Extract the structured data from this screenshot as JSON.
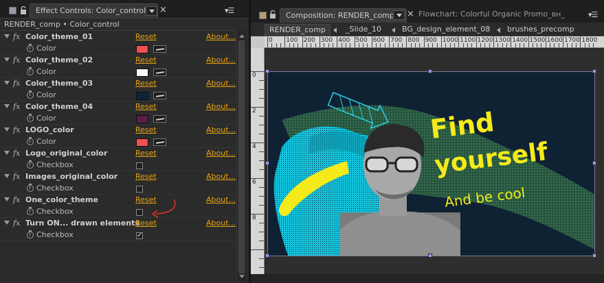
{
  "left_panel": {
    "tab_title": "Effect Controls: Color_control",
    "breadcrumb": "RENDER_comp • Color_control",
    "effects": [
      {
        "name": "Color_theme_01",
        "reset": "Reset",
        "about": "About...",
        "prop": "Color",
        "kind": "color",
        "color": "#f25050"
      },
      {
        "name": "Color_theme_02",
        "reset": "Reset",
        "about": "About...",
        "prop": "Color",
        "kind": "color",
        "color": "#f4faf2"
      },
      {
        "name": "Color_theme_03",
        "reset": "Reset",
        "about": "About...",
        "prop": "Color",
        "kind": "color",
        "color": "#0c2436"
      },
      {
        "name": "Color_theme_04",
        "reset": "Reset",
        "about": "About...",
        "prop": "Color",
        "kind": "color",
        "color": "#5a1e46"
      },
      {
        "name": "LOGO_color",
        "reset": "Reset",
        "about": "About...",
        "prop": "Color",
        "kind": "color",
        "color": "#f25050"
      },
      {
        "name": "Logo_original_color",
        "reset": "Reset",
        "about": "About...",
        "prop": "Checkbox",
        "kind": "checkbox",
        "checked": false
      },
      {
        "name": "Images_original_color",
        "reset": "Reset",
        "about": "About...",
        "prop": "Checkbox",
        "kind": "checkbox",
        "checked": false
      },
      {
        "name": "One_color_theme",
        "reset": "Reset",
        "about": "About...",
        "prop": "Checkbox",
        "kind": "checkbox",
        "checked": false
      },
      {
        "name": "Turn ON... drawn elements",
        "reset": "Reset",
        "about": "About...",
        "prop": "Checkbox",
        "kind": "checkbox",
        "checked": true
      }
    ],
    "checkmark_glyph": "✓",
    "fx_glyph": "fx"
  },
  "right_panel": {
    "tab_title": "Composition: RENDER_comp",
    "second_tab_title": "Flowchart: Colorful Organic Promo_вн_",
    "layer_tabs": [
      "RENDER_comp",
      "_Slide_10",
      "BG_design_element_08",
      "brushes_precomp"
    ],
    "ruler_labels": [
      "0",
      "100",
      "200",
      "300",
      "400",
      "500",
      "600",
      "700",
      "800",
      "900",
      "1000",
      "1100",
      "1200",
      "1300",
      "1400",
      "1500",
      "1600",
      "1700",
      "1800"
    ],
    "vruler_labels": [
      "0",
      "2",
      "4",
      "6",
      "8"
    ]
  },
  "artwork": {
    "headline_1": "Find",
    "headline_2": "yourself",
    "subline": "And be cool",
    "bg_color": "#0f2233",
    "accent_color": "#f5ea1a",
    "brush_color": "#12c8e0",
    "stroke_color": "#2e6a45"
  }
}
